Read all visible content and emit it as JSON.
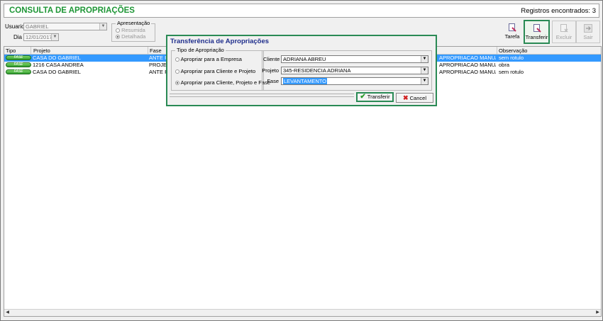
{
  "header": {
    "title": "CONSULTA DE APROPRIAÇÕES",
    "record_count": "Registros encontrados: 3"
  },
  "filters": {
    "usuario_label": "Usuario",
    "usuario_value": "GABRIEL",
    "dia_label": "Dia",
    "dia_value": "12/01/2017",
    "apresentacao_title": "Apresentação",
    "option_resumida": "Resumida",
    "option_detalhada": "Detalhada"
  },
  "toolbar": {
    "tarefa": "Tarefa",
    "transferir": "Transferir",
    "excluir": "Excluir",
    "sair": "Sair"
  },
  "grid": {
    "columns": {
      "tipo": "Tipo",
      "projeto": "Projeto",
      "fase": "Fase",
      "observacao": "Observação"
    },
    "rows": [
      {
        "tipo": "FASE",
        "projeto": "CASA DO GABRIEL",
        "fase": "ANTE P",
        "apropriacao": "APROPRIACAO MANUAL",
        "observacao": "sem rotulo"
      },
      {
        "tipo": "FASE",
        "projeto": "1216 CASA ANDREA",
        "fase": "PROJET",
        "apropriacao": "APROPRIACAO MANUAL",
        "observacao": "obra"
      },
      {
        "tipo": "FASE",
        "projeto": "CASA DO GABRIEL",
        "fase": "ANTE P",
        "apropriacao": "APROPRIACAO MANUAL",
        "observacao": "sem rotulo"
      }
    ]
  },
  "dialog": {
    "title": "Transferência de Apropriações",
    "group_title": "Tipo de Apropriação",
    "options": [
      "Apropriar para a Empresa",
      "Apropriar para Cliente e Projeto",
      "Apropriar para Cliente, Projeto e Fase"
    ],
    "cliente_label": "Cliente",
    "cliente_value": "ADRIANA ABREU",
    "projeto_label": "Projeto",
    "projeto_value": "345-RESIDENCIA ADRIANA",
    "fase_label": "Fase",
    "fase_value": "LEVANTAMENTO",
    "transferir_button": "Transferir",
    "cancel_button": "Cancel"
  }
}
